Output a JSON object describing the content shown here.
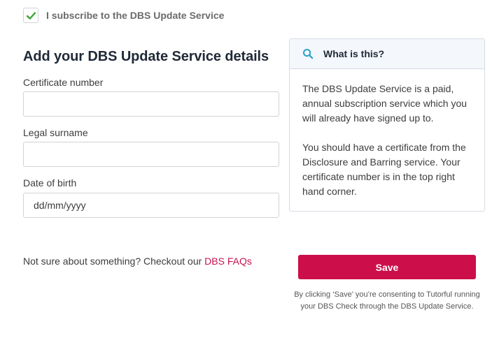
{
  "subscribe": {
    "checked": true,
    "label": "I subscribe to the DBS Update Service"
  },
  "form": {
    "title": "Add your DBS Update Service details",
    "fields": [
      {
        "label": "Certificate number",
        "value": "",
        "placeholder": ""
      },
      {
        "label": "Legal surname",
        "value": "",
        "placeholder": ""
      },
      {
        "label": "Date of birth",
        "value": "",
        "placeholder": "dd/mm/yyyy"
      }
    ]
  },
  "info": {
    "title": "What is this?",
    "icon": "search-icon",
    "paragraphs": [
      "The DBS Update Service is a paid, annual subscription service which you will already have signed up to.",
      "You should have a certificate from the Disclosure and Barring service. Your certificate number is in the top right hand corner."
    ]
  },
  "help": {
    "text": "Not sure about something? Checkout our",
    "link_label": "DBS FAQs"
  },
  "actions": {
    "save_label": "Save",
    "consent": "By clicking ‘Save’ you’re consenting to Tutorful running your DBS Check through the DBS Update Service."
  },
  "colors": {
    "accent": "#cc0e4b",
    "check": "#3aaa35",
    "info_icon": "#29a3c6"
  }
}
